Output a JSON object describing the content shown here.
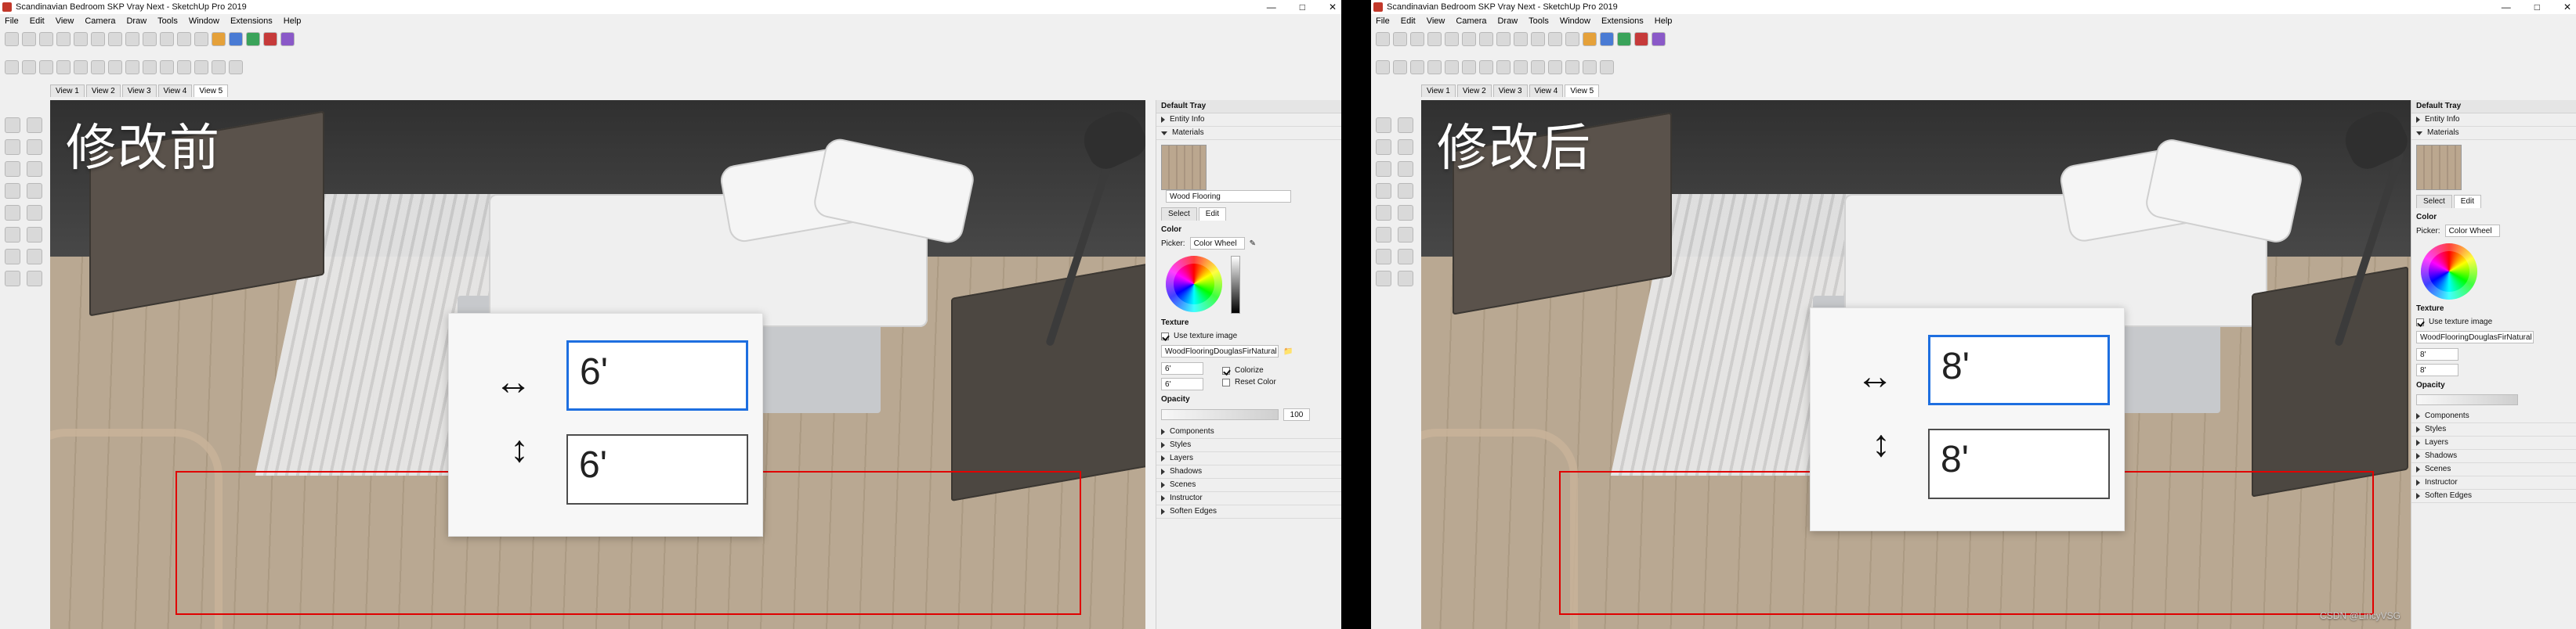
{
  "app": {
    "window_title": "Scandinavian Bedroom SKP Vray Next - SketchUp Pro 2019",
    "menu": [
      "File",
      "Edit",
      "View",
      "Camera",
      "Draw",
      "Tools",
      "Window",
      "Extensions",
      "Help"
    ],
    "scene_tabs": [
      "View 1",
      "View 2",
      "View 3",
      "View 4",
      "View 5"
    ],
    "active_scene_tab": "View 5"
  },
  "left": {
    "caption": "修改前",
    "scale_width": "6'",
    "scale_height": "6'"
  },
  "right": {
    "caption": "修改后",
    "scale_width": "8'",
    "scale_height": "8'"
  },
  "tray": {
    "title": "Default Tray",
    "sections": [
      "Entity Info",
      "Materials"
    ],
    "material_name": "Wood Flooring",
    "tabs": [
      "Select",
      "Edit"
    ],
    "color_label": "Color",
    "picker_label": "Picker:",
    "picker_value": "Color Wheel",
    "texture_label": "Texture",
    "use_texture_label": "Use texture image",
    "texture_file": "WoodFlooringDouglasFirNatural",
    "texture_w": "6'",
    "texture_h": "6'",
    "colorize_label": "Colorize",
    "reset_color_label": "Reset Color",
    "opacity_label": "Opacity",
    "opacity_value": "100",
    "collapsed": [
      "Components",
      "Styles",
      "Layers",
      "Shadows",
      "Scenes",
      "Instructor",
      "Soften Edges"
    ]
  },
  "watermark": "CSDN @LincyVSG",
  "colors": {
    "accent_blue": "#1e6fe0",
    "annotation_red": "#e00000"
  }
}
